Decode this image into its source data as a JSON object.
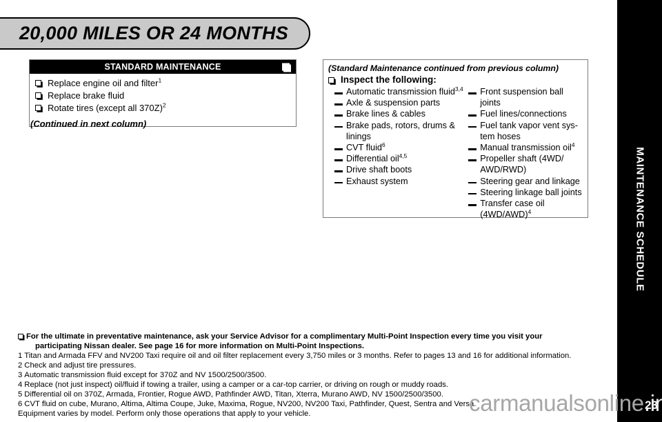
{
  "banner": {
    "title": "20,000 MILES OR 24 MONTHS"
  },
  "side_tab": {
    "label": "MAINTENANCE SCHEDULE",
    "page_number": "23",
    "background_color": "#000000",
    "text_color": "#ffffff"
  },
  "left_panel": {
    "header_title": "STANDARD MAINTENANCE",
    "header_checkbox_icon": "checkbox-icon",
    "items": [
      {
        "text": "Replace engine oil and filter",
        "sup": "1"
      },
      {
        "text": "Replace brake fluid",
        "sup": ""
      },
      {
        "text": "Rotate tires (except all 370Z)",
        "sup": "2"
      }
    ],
    "continued_note": "(Continued in next column)"
  },
  "right_panel": {
    "continued_header": "(Standard Maintenance continued from previous column)",
    "inspect_label": "Inspect the following:",
    "column_left": [
      {
        "text": "Automatic transmission fluid",
        "sup": "3,4"
      },
      {
        "text": "Axle & suspension parts",
        "sup": ""
      },
      {
        "text": "Brake lines & cables",
        "sup": ""
      },
      {
        "text": "Brake pads, rotors, drums & linings",
        "sup": ""
      },
      {
        "text": "CVT fluid",
        "sup": "6"
      },
      {
        "text": "Differential oil",
        "sup": "4,5"
      },
      {
        "text": "Drive shaft boots",
        "sup": ""
      },
      {
        "text": "Exhaust system",
        "sup": ""
      }
    ],
    "column_right": [
      {
        "text": "Front suspension ball joints",
        "sup": ""
      },
      {
        "text": "Fuel lines/connections",
        "sup": ""
      },
      {
        "text": "Fuel tank vapor vent sys- tem hoses",
        "sup": ""
      },
      {
        "text": "Manual transmission oil",
        "sup": "4"
      },
      {
        "text": "Propeller shaft (4WD/ AWD/RWD)",
        "sup": ""
      },
      {
        "text": "Steering gear and linkage",
        "sup": ""
      },
      {
        "text": "Steering linkage ball joints",
        "sup": ""
      },
      {
        "text": "Transfer case oil (4WD/AWD)",
        "sup": "4"
      }
    ]
  },
  "footnotes": {
    "lead_line1": "For the ultimate in preventative maintenance, ask your Service Advisor for a complimentary Multi-Point Inspection every time you visit your",
    "lead_line2": "participating Nissan dealer. See page 16 for more information on Multi-Point Inspections.",
    "notes": [
      {
        "num": "1",
        "text": "Titan and Armada FFV and NV200 Taxi require oil and oil filter replacement every 3,750 miles or 3 months. Refer to pages 13 and 16 for additional information."
      },
      {
        "num": "2",
        "text": "Check and adjust tire pressures."
      },
      {
        "num": "3",
        "text": "Automatic transmission fluid except for 370Z and NV 1500/2500/3500."
      },
      {
        "num": "4",
        "text": "Replace (not just inspect) oil/fluid if towing a trailer, using a camper or a car-top carrier, or driving on rough or muddy roads."
      },
      {
        "num": "5",
        "text": "Differential oil on 370Z, Armada, Frontier, Rogue AWD, Pathfinder AWD, Titan, Xterra, Murano AWD, NV 1500/2500/3500."
      },
      {
        "num": "6",
        "text": "CVT fluid on cube, Murano, Altima, Altima Coupe, Juke, Maxima, Rogue, NV200, NV200 Taxi, Pathfinder, Quest, Sentra and Versa."
      }
    ],
    "closing": "Equipment varies by model. Perform only those operations that apply to your vehicle."
  },
  "watermark": {
    "text_light": "carmanualsonline",
    "text_onblack": ".info",
    "color": "#a6a6a6"
  }
}
